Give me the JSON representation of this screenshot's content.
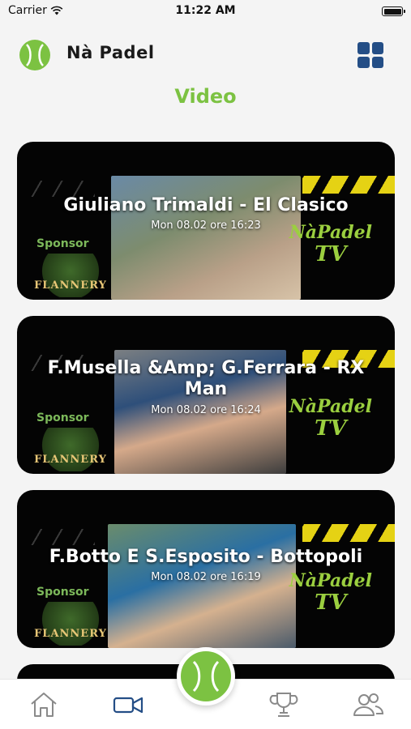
{
  "status": {
    "carrier": "Carrier",
    "time": "11:22 AM"
  },
  "header": {
    "app_name": "Nà Padel",
    "menu_icon": "grid-icon"
  },
  "page": {
    "title": "Video"
  },
  "videos": [
    {
      "title": "Giuliano Trimaldi - El Clasico",
      "date": "Mon 08.02 ore 16:23",
      "sponsor_label": "Sponsor",
      "sponsor_name": "FLANNERY",
      "brand_line1": "NàPadel",
      "brand_line2": "TV"
    },
    {
      "title": "F.Musella &Amp; G.Ferrara - RX Man",
      "date": "Mon 08.02 ore 16:24",
      "sponsor_label": "Sponsor",
      "sponsor_name": "FLANNERY",
      "brand_line1": "NàPadel",
      "brand_line2": "TV"
    },
    {
      "title": "F.Botto E S.Esposito - Bottopoli",
      "date": "Mon 08.02 ore 16:19",
      "sponsor_label": "Sponsor",
      "sponsor_name": "FLANNERY",
      "brand_line1": "NàPadel",
      "brand_line2": "TV"
    }
  ],
  "tabs": [
    {
      "name": "home",
      "icon": "home-icon"
    },
    {
      "name": "video",
      "icon": "video-camera-icon",
      "active": true
    },
    {
      "name": "center",
      "icon": "tennis-ball-icon"
    },
    {
      "name": "trophy",
      "icon": "trophy-icon"
    },
    {
      "name": "people",
      "icon": "people-icon"
    }
  ],
  "colors": {
    "accent_green": "#7cc242",
    "brand_blue": "#244e86",
    "stripe_yellow": "#e5d214",
    "card_bg": "#040404"
  }
}
